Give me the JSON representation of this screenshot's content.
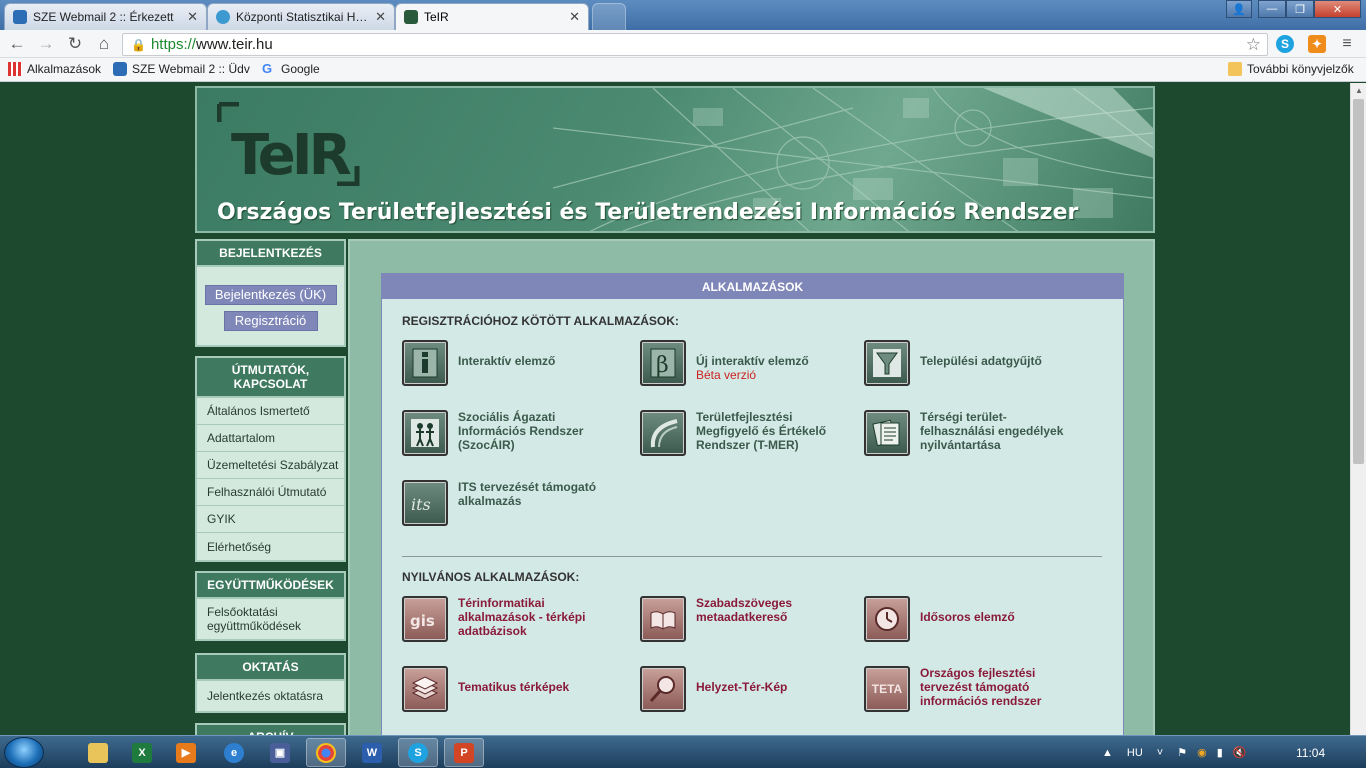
{
  "browser": {
    "tabs": [
      {
        "title": "SZE Webmail 2 :: Érkezett",
        "active": false
      },
      {
        "title": "Központi Statisztikai Hivat",
        "active": false
      },
      {
        "title": "TeIR",
        "active": true
      }
    ],
    "url_protocol": "https://",
    "url_host": "www.teir.hu",
    "bookmarks": [
      "Alkalmazások",
      "SZE Webmail 2 :: Üdv",
      "Google"
    ],
    "other_bookmarks": "További könyvjelzők"
  },
  "header": {
    "logo": "TeIR",
    "title": "Országos Területfejlesztési és Területrendezési Információs Rendszer"
  },
  "sidebar": {
    "login": {
      "heading": "BEJELENTKEZÉS",
      "login_button": "Bejelentkezés (ÜK)",
      "register_button": "Regisztráció"
    },
    "guides": {
      "heading": "ÚTMUTATÓK, KAPCSOLAT",
      "items": [
        "Általános Ismertető",
        "Adattartalom",
        "Üzemeltetési Szabályzat",
        "Felhasználói Útmutató",
        "GYIK",
        "Elérhetőség"
      ]
    },
    "coop": {
      "heading": "EGYÜTTMŰKÖDÉSEK",
      "items": [
        "Felsőoktatási együttműködések"
      ]
    },
    "education": {
      "heading": "OKTATÁS",
      "items": [
        "Jelentkezés oktatásra"
      ]
    },
    "archive": {
      "heading": "ARCHÍV"
    }
  },
  "main": {
    "panel_title": "ALKALMAZÁSOK",
    "registered_title": "REGISZTRÁCIÓHOZ KÖTÖTT ALKALMAZÁSOK:",
    "registered_apps": [
      {
        "label": "Interaktív elemző",
        "icon": "info-icon"
      },
      {
        "label": "Új interaktív elemző",
        "sub": "Béta verzió",
        "icon": "beta-icon"
      },
      {
        "label": "Települési adatgyűjtő",
        "icon": "funnel-icon"
      },
      {
        "label": " Szociális Ágazati Információs Rendszer (SzocÁIR)",
        "icon": "people-icon"
      },
      {
        "label": "Területfejlesztési Megfigyelő és Értékelő Rendszer (T-MER)",
        "icon": "curve-icon"
      },
      {
        "label": "Térségi terület-felhasználási engedélyek nyilvántartása",
        "icon": "document-icon"
      },
      {
        "label": "ITS tervezését támogató alkalmazás",
        "icon": "its-icon"
      }
    ],
    "public_title": "NYILVÁNOS ALKALMAZÁSOK:",
    "public_apps": [
      {
        "label": "Térinformatikai alkalmazások - térképi adatbázisok",
        "icon": "gis-icon"
      },
      {
        "label": "Szabadszöveges metaadatkereső",
        "icon": "book-icon"
      },
      {
        "label": "Idősoros elemző",
        "icon": "clock-icon"
      },
      {
        "label": "Tematikus térképek",
        "icon": "layers-icon"
      },
      {
        "label": "Helyzet-Tér-Kép",
        "icon": "magnifier-icon"
      },
      {
        "label": "Országos fejlesztési tervezést támogató információs rendszer",
        "icon": "teta-icon",
        "icon_text": "TETA"
      }
    ]
  },
  "taskbar": {
    "language": "HU",
    "time": "11:04"
  }
}
